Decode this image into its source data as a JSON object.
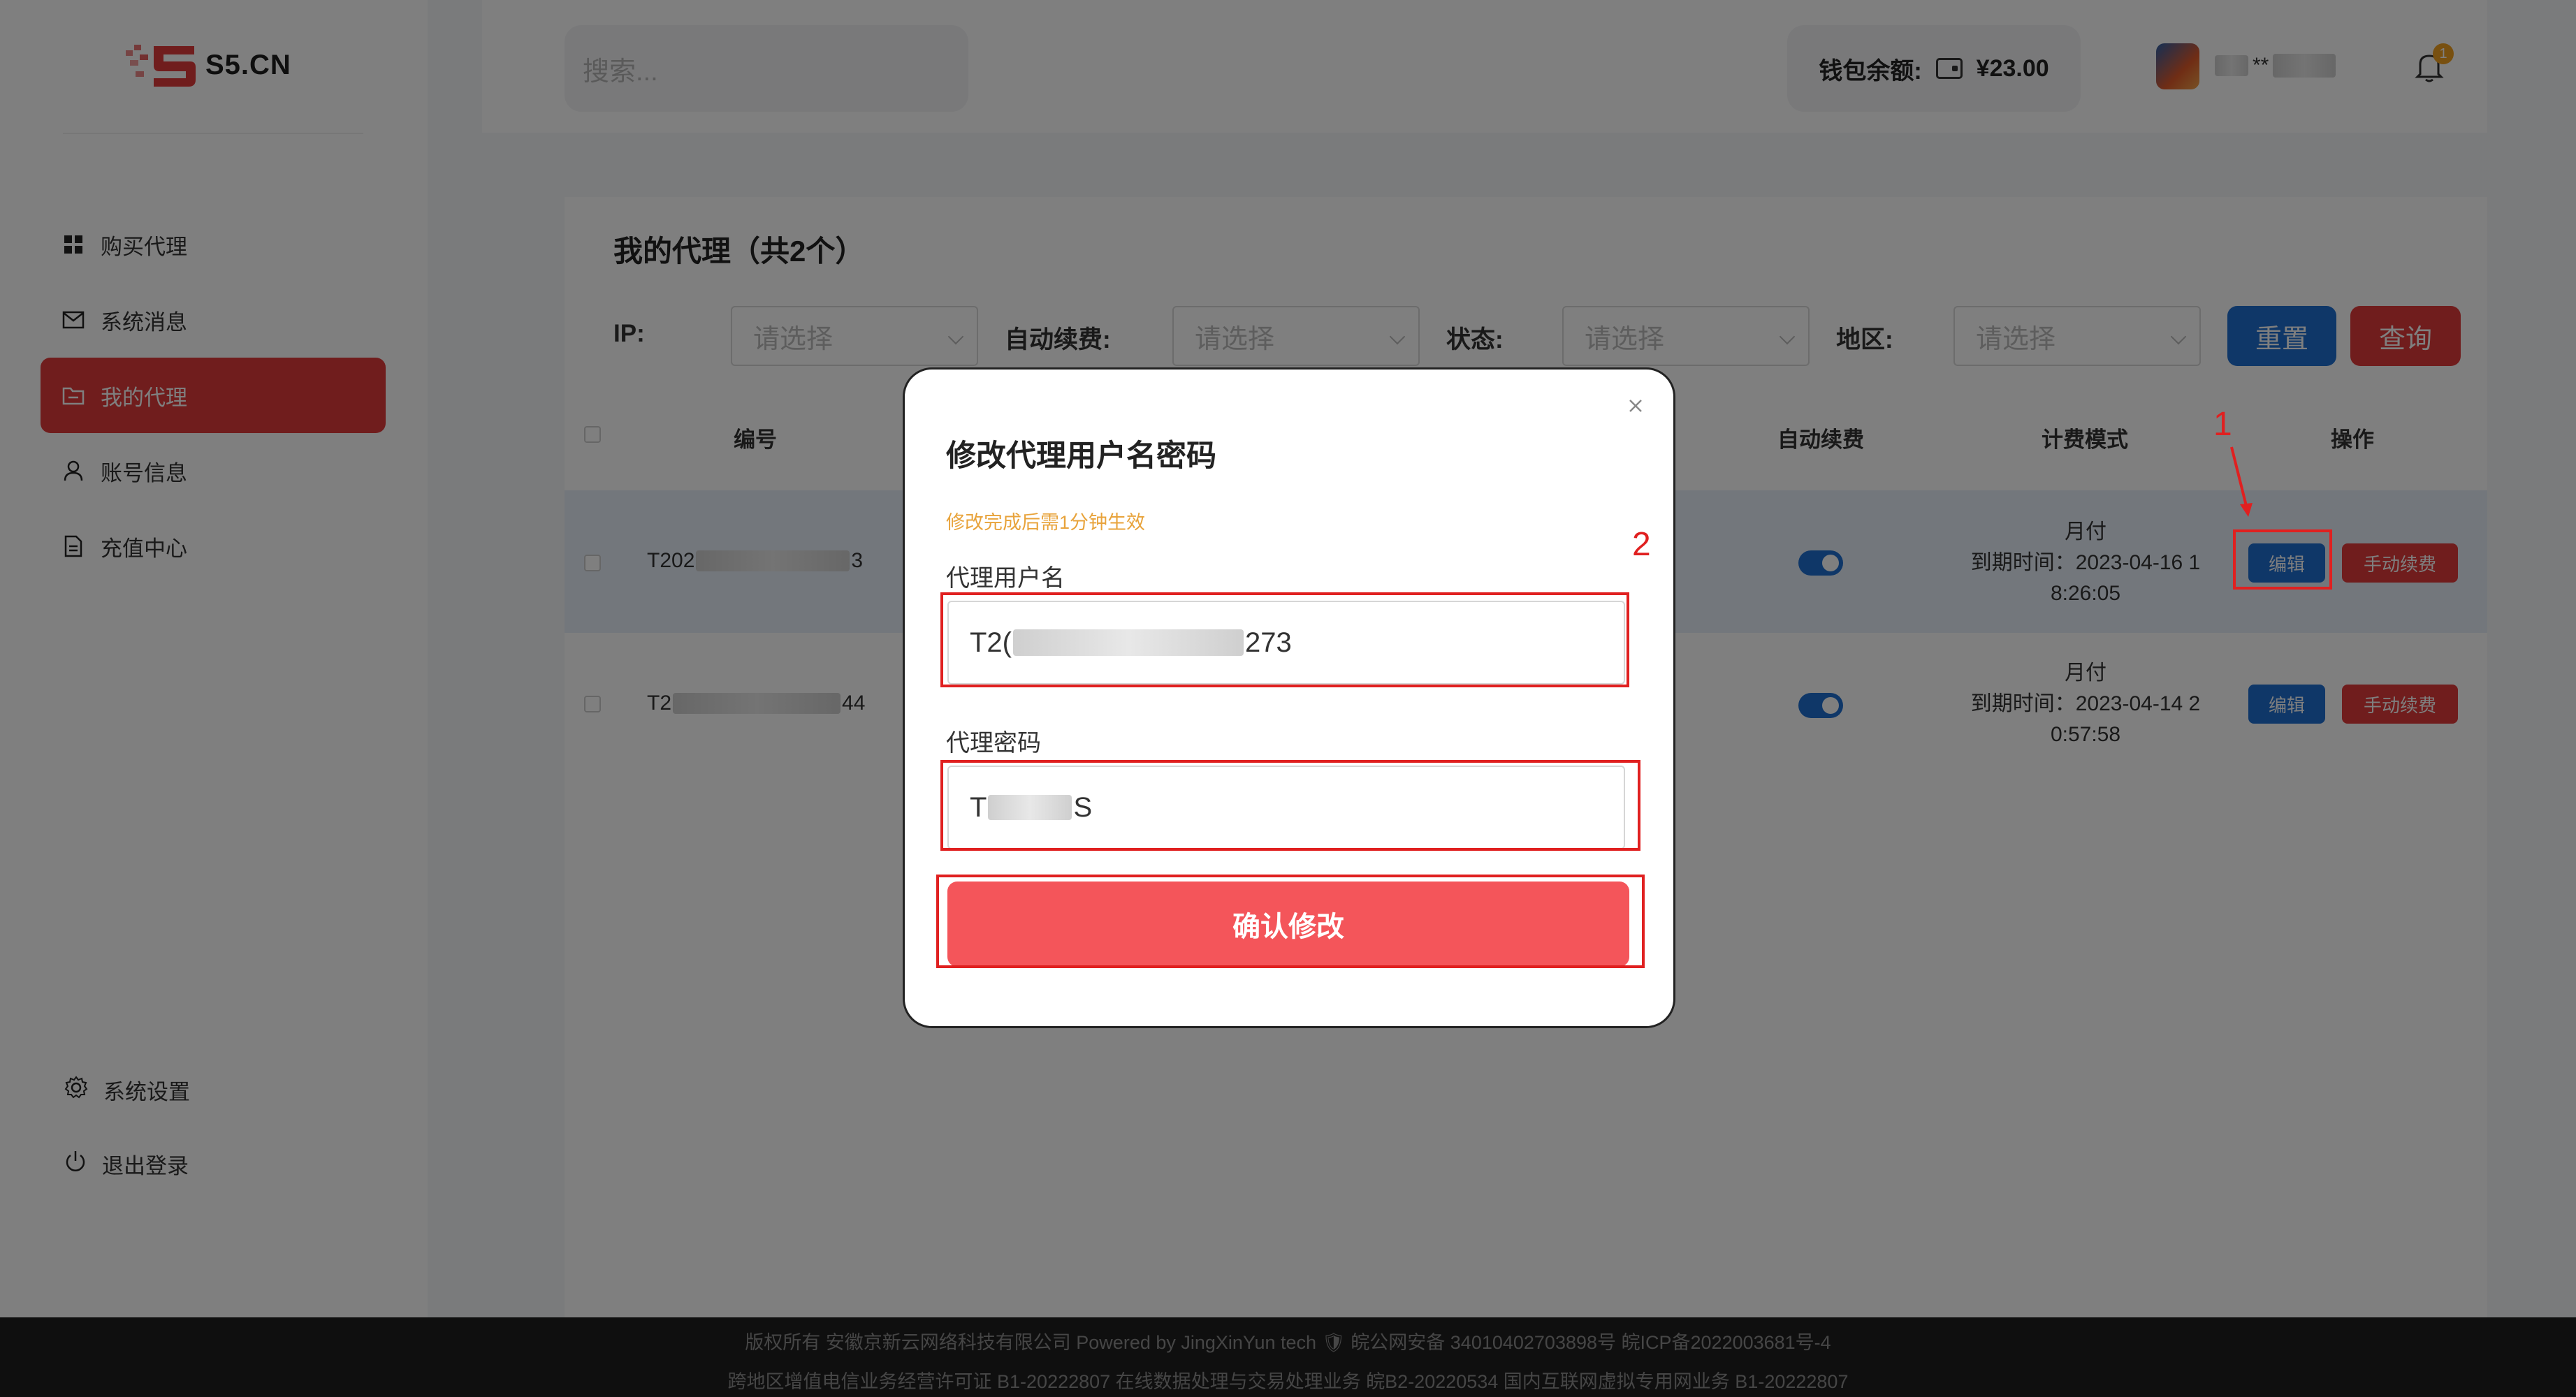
{
  "brand": {
    "name": "S5.CN"
  },
  "sidebar": {
    "items": [
      {
        "label": "购买代理",
        "icon": "grid-icon"
      },
      {
        "label": "系统消息",
        "icon": "mail-icon"
      },
      {
        "label": "我的代理",
        "icon": "folder-icon",
        "active": true
      },
      {
        "label": "账号信息",
        "icon": "user-icon"
      },
      {
        "label": "充值中心",
        "icon": "document-icon"
      }
    ],
    "bottom": [
      {
        "label": "系统设置",
        "icon": "gear-icon"
      },
      {
        "label": "退出登录",
        "icon": "power-icon"
      }
    ]
  },
  "header": {
    "search_placeholder": "搜索...",
    "wallet_label": "钱包余额:",
    "wallet_amount": "¥23.00",
    "username_visible": "**",
    "notification_count": "1"
  },
  "main": {
    "title": "我的代理（共2个）",
    "filters": [
      {
        "label": "IP:",
        "placeholder": "请选择"
      },
      {
        "label": "自动续费:",
        "placeholder": "请选择"
      },
      {
        "label": "状态:",
        "placeholder": "请选择"
      },
      {
        "label": "地区:",
        "placeholder": "请选择"
      }
    ],
    "reset_label": "重置",
    "query_label": "查询",
    "table": {
      "headers": {
        "id": "编号",
        "auto_renew": "自动续费",
        "billing": "计费模式",
        "actions": "操作"
      },
      "rows": [
        {
          "id_prefix": "T202",
          "id_suffix": "3",
          "auto_renew": true,
          "billing_mode": "月付",
          "expiry_line1": "到期时间：2023-04-16 1",
          "expiry_line2": "8:26:05",
          "edit_label": "编辑",
          "renew_label": "手动续费"
        },
        {
          "id_prefix": "T2",
          "id_suffix": "44",
          "auto_renew": true,
          "billing_mode": "月付",
          "expiry_line1": "到期时间：2023-04-14 2",
          "expiry_line2": "0:57:58",
          "edit_label": "编辑",
          "renew_label": "手动续费"
        }
      ]
    }
  },
  "modal": {
    "title": "修改代理用户名密码",
    "tip": "修改完成后需1分钟生效",
    "username_label": "代理用户名",
    "username_prefix": "T2(",
    "username_suffix": "273",
    "password_label": "代理密码",
    "password_prefix": "T",
    "password_suffix": "S",
    "confirm_label": "确认修改"
  },
  "annotations": {
    "step1": "1",
    "step2": "2"
  },
  "footer": {
    "line1": "版权所有 安徽京新云网络科技有限公司 Powered by JingXinYun tech 🛡 皖公网安备 34010402703898号 皖ICP备2022003681号-4",
    "line2": "跨地区增值电信业务经营许可证 B1-20222807 在线数据处理与交易处理业务 皖B2-20220534 国内互联网虚拟专用网业务 B1-20222807"
  },
  "colors": {
    "primary_red": "#e13a3a",
    "primary_blue": "#1e6fd0",
    "confirm_red": "#f4555a",
    "tip_orange": "#e8a33b"
  }
}
